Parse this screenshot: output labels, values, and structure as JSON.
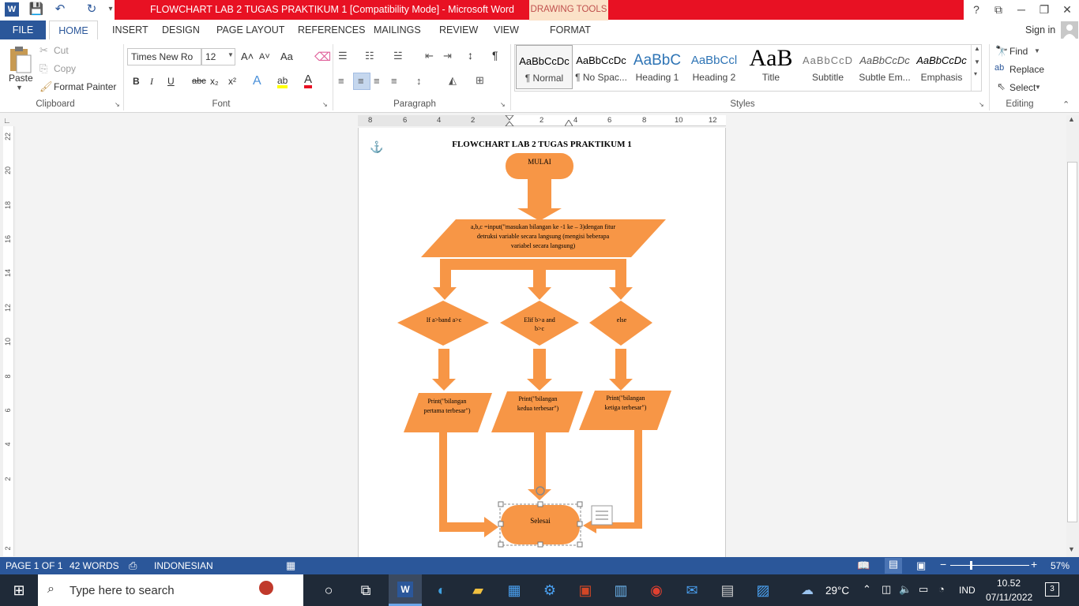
{
  "window": {
    "title": "FLOWCHART LAB 2 TUGAS PRAKTIKUM 1 [Compatibility Mode] - Microsoft Word",
    "contextual_tab_group": "DRAWING TOOLS",
    "help": "?",
    "restore_ribbon": "⧉",
    "minimize": "─",
    "maximize": "❐",
    "close": "✕"
  },
  "quick_access": {
    "word_icon": "W",
    "save": "💾",
    "undo": "↶",
    "redo": "↻",
    "customize": "▾"
  },
  "tabs": [
    "FILE",
    "HOME",
    "INSERT",
    "DESIGN",
    "PAGE LAYOUT",
    "REFERENCES",
    "MAILINGS",
    "REVIEW",
    "VIEW",
    "FORMAT"
  ],
  "account": {
    "sign_in": "Sign in"
  },
  "clipboard": {
    "paste": "Paste",
    "cut": "Cut",
    "copy": "Copy",
    "format_painter": "Format Painter",
    "group_label": "Clipboard"
  },
  "font": {
    "name": "Times New Ro",
    "size": "12",
    "group_label": "Font",
    "bold": "B",
    "italic": "I",
    "underline": "U",
    "strike": "abc",
    "subscript": "x₂",
    "superscript": "x²",
    "grow": "A˄",
    "shrink": "A˅",
    "change_case": "Aa",
    "text_effects": "A",
    "highlight": "ab",
    "font_color": "A"
  },
  "paragraph": {
    "group_label": "Paragraph",
    "pilcrow": "¶",
    "sort": "↕"
  },
  "styles": {
    "group_label": "Styles",
    "items": [
      {
        "preview": "AaBbCcDc",
        "label": "¶ Normal"
      },
      {
        "preview": "AaBbCcDc",
        "label": "¶ No Spac..."
      },
      {
        "preview": "AaBbC",
        "label": "Heading 1"
      },
      {
        "preview": "AaBbCcl",
        "label": "Heading 2"
      },
      {
        "preview": "AaB",
        "label": "Title"
      },
      {
        "preview": "AaBbCcD",
        "label": "Subtitle"
      },
      {
        "preview": "AaBbCcDc",
        "label": "Subtle Em..."
      },
      {
        "preview": "AaBbCcDc",
        "label": "Emphasis"
      }
    ]
  },
  "editing": {
    "find": "Find",
    "replace": "Replace",
    "select": "Select",
    "group_label": "Editing"
  },
  "ruler_h": [
    "8",
    "6",
    "4",
    "2",
    "2",
    "4",
    "6",
    "8",
    "10",
    "12"
  ],
  "ruler_v": [
    "22",
    "20",
    "18",
    "16",
    "14",
    "12",
    "10",
    "8",
    "6",
    "4",
    "2",
    "2"
  ],
  "document": {
    "heading": "FLOWCHART LAB 2 TUGAS PRAKTIKUM 1",
    "flowchart": {
      "start": "MULAI",
      "input": "a,b,c =input(\"masukan bilangan ke -1 ke – 3)dengan fitur detruksi variable secara langsung (mengisi beberapa variabel secara langsung)",
      "decisions": [
        "If a>band a>c",
        "Elif b>a and b>c",
        "else"
      ],
      "outputs": [
        "Print(\"bilangan pertama terbesar\")",
        "Print(\"bilangan kedua terbesar\")",
        "Print(\"bilangan ketiga terbesar\")"
      ],
      "end": "Selesai"
    }
  },
  "statusbar": {
    "page": "PAGE 1 OF 1",
    "words": "42 WORDS",
    "language": "INDONESIAN",
    "zoom": "57%",
    "zoom_minus": "−",
    "zoom_plus": "+"
  },
  "taskbar": {
    "search_placeholder": "Type here to search",
    "weather": "29°C",
    "lang": "IND",
    "time": "10.52",
    "date": "07/11/2022",
    "notifications": "3"
  },
  "colors": {
    "shape_fill": "#f79646",
    "word_blue": "#2b579a",
    "title_red": "#e81123",
    "taskbar": "#1f2a38"
  }
}
